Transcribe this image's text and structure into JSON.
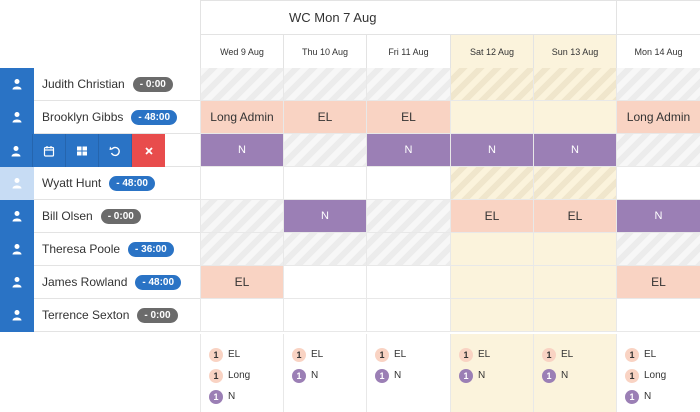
{
  "week": {
    "title": "WC Mon 7 Aug"
  },
  "days": [
    {
      "label": "Wed 9 Aug",
      "weekend": false
    },
    {
      "label": "Thu 10 Aug",
      "weekend": false
    },
    {
      "label": "Fri 11 Aug",
      "weekend": false
    },
    {
      "label": "Sat 12 Aug",
      "weekend": true
    },
    {
      "label": "Sun 13 Aug",
      "weekend": true
    },
    {
      "label": "Mon 14 Aug",
      "weekend": false
    }
  ],
  "staff": [
    {
      "name": "Judith Christian",
      "hours": "- 0:00",
      "badge": "grey"
    },
    {
      "name": "Brooklyn Gibbs",
      "hours": "- 48:00",
      "badge": "blue"
    },
    {
      "name": "",
      "hours": "",
      "badge": ""
    },
    {
      "name": "Wyatt Hunt",
      "hours": "- 48:00",
      "badge": "blue"
    },
    {
      "name": "Bill Olsen",
      "hours": "- 0:00",
      "badge": "grey"
    },
    {
      "name": "Theresa Poole",
      "hours": "- 36:00",
      "badge": "blue"
    },
    {
      "name": "James Rowland",
      "hours": "- 48:00",
      "badge": "blue"
    },
    {
      "name": "Terrence Sexton",
      "hours": "- 0:00",
      "badge": "grey"
    }
  ],
  "actions": [
    "person-icon",
    "calendar-icon",
    "grid-icon",
    "undo-icon",
    "close-icon"
  ],
  "grid": [
    [
      {
        "t": "hatch",
        "v": ""
      },
      {
        "t": "hatch",
        "v": ""
      },
      {
        "t": "hatch",
        "v": ""
      },
      {
        "t": "hatch-weekend",
        "v": ""
      },
      {
        "t": "hatch-weekend",
        "v": ""
      },
      {
        "t": "hatch",
        "v": ""
      }
    ],
    [
      {
        "t": "shift-el",
        "v": "Long Admin"
      },
      {
        "t": "shift-el",
        "v": "EL"
      },
      {
        "t": "shift-el",
        "v": "EL"
      },
      {
        "t": "weekend",
        "v": ""
      },
      {
        "t": "weekend",
        "v": ""
      },
      {
        "t": "shift-el",
        "v": "Long Admin"
      }
    ],
    [
      {
        "t": "shift-n",
        "v": "N"
      },
      {
        "t": "hatch",
        "v": ""
      },
      {
        "t": "shift-n",
        "v": "N"
      },
      {
        "t": "shift-n",
        "v": "N"
      },
      {
        "t": "shift-n",
        "v": "N"
      },
      {
        "t": "hatch",
        "v": ""
      }
    ],
    [
      {
        "t": "empty",
        "v": ""
      },
      {
        "t": "empty",
        "v": ""
      },
      {
        "t": "empty",
        "v": ""
      },
      {
        "t": "hatch-weekend",
        "v": ""
      },
      {
        "t": "hatch-weekend",
        "v": ""
      },
      {
        "t": "empty",
        "v": ""
      }
    ],
    [
      {
        "t": "hatch",
        "v": ""
      },
      {
        "t": "shift-n",
        "v": "N"
      },
      {
        "t": "hatch",
        "v": ""
      },
      {
        "t": "shift-el",
        "v": "EL"
      },
      {
        "t": "shift-el",
        "v": "EL"
      },
      {
        "t": "shift-n",
        "v": "N"
      }
    ],
    [
      {
        "t": "hatch",
        "v": ""
      },
      {
        "t": "hatch",
        "v": ""
      },
      {
        "t": "hatch",
        "v": ""
      },
      {
        "t": "weekend",
        "v": ""
      },
      {
        "t": "weekend",
        "v": ""
      },
      {
        "t": "hatch",
        "v": ""
      }
    ],
    [
      {
        "t": "shift-el",
        "v": "EL"
      },
      {
        "t": "empty",
        "v": ""
      },
      {
        "t": "empty",
        "v": ""
      },
      {
        "t": "weekend",
        "v": ""
      },
      {
        "t": "weekend",
        "v": ""
      },
      {
        "t": "shift-el",
        "v": "EL"
      }
    ],
    [
      {
        "t": "empty",
        "v": ""
      },
      {
        "t": "empty",
        "v": ""
      },
      {
        "t": "empty",
        "v": ""
      },
      {
        "t": "weekend",
        "v": ""
      },
      {
        "t": "weekend",
        "v": ""
      },
      {
        "t": "empty",
        "v": ""
      }
    ]
  ],
  "summary": [
    [
      {
        "count": "1",
        "type": "el",
        "label": "EL"
      },
      {
        "count": "1",
        "type": "long",
        "label": "Long"
      },
      {
        "count": "1",
        "type": "n",
        "label": "N"
      }
    ],
    [
      {
        "count": "1",
        "type": "el",
        "label": "EL"
      },
      {
        "count": "1",
        "type": "n",
        "label": "N"
      }
    ],
    [
      {
        "count": "1",
        "type": "el",
        "label": "EL"
      },
      {
        "count": "1",
        "type": "n",
        "label": "N"
      }
    ],
    [
      {
        "count": "1",
        "type": "el",
        "label": "EL"
      },
      {
        "count": "1",
        "type": "n",
        "label": "N"
      }
    ],
    [
      {
        "count": "1",
        "type": "el",
        "label": "EL"
      },
      {
        "count": "1",
        "type": "n",
        "label": "N"
      }
    ],
    [
      {
        "count": "1",
        "type": "el",
        "label": "EL"
      },
      {
        "count": "1",
        "type": "long",
        "label": "Long"
      },
      {
        "count": "1",
        "type": "n",
        "label": "N"
      }
    ]
  ]
}
